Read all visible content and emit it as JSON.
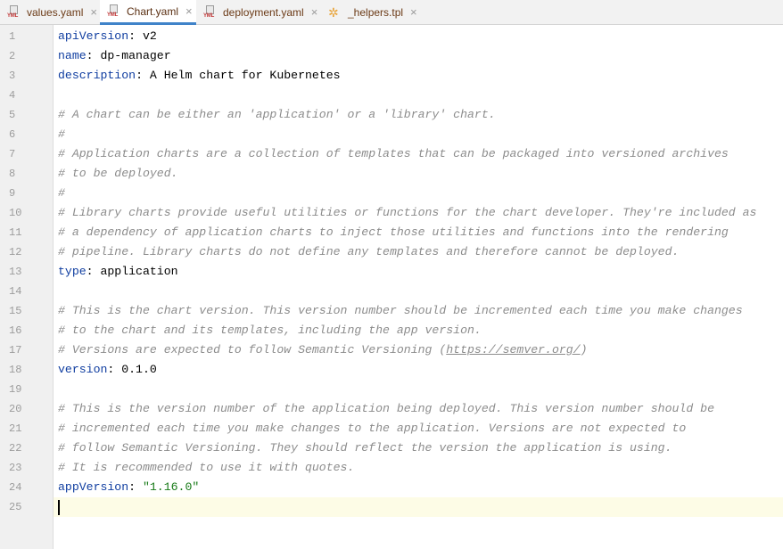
{
  "tabs": [
    {
      "name": "values.yaml",
      "type": "yml",
      "close": "×",
      "active": false
    },
    {
      "name": "Chart.yaml",
      "type": "yml",
      "close": "×",
      "active": true
    },
    {
      "name": "deployment.yaml",
      "type": "yml",
      "close": "×",
      "active": false
    },
    {
      "name": "_helpers.tpl",
      "type": "tpl",
      "close": "×",
      "active": false
    }
  ],
  "file_icon_label": "YML",
  "editor": {
    "current_line": 25,
    "lines": [
      {
        "n": "1",
        "segs": [
          {
            "t": "apiVersion",
            "c": "key"
          },
          {
            "t": ": v2",
            "c": ""
          }
        ]
      },
      {
        "n": "2",
        "segs": [
          {
            "t": "name",
            "c": "key"
          },
          {
            "t": ": dp-manager",
            "c": ""
          }
        ]
      },
      {
        "n": "3",
        "segs": [
          {
            "t": "description",
            "c": "key"
          },
          {
            "t": ": A Helm chart for Kubernetes",
            "c": ""
          }
        ]
      },
      {
        "n": "4",
        "segs": []
      },
      {
        "n": "5",
        "segs": [
          {
            "t": "# A chart can be either an 'application' or a 'library' chart.",
            "c": "cmt"
          }
        ]
      },
      {
        "n": "6",
        "segs": [
          {
            "t": "#",
            "c": "cmt"
          }
        ]
      },
      {
        "n": "7",
        "segs": [
          {
            "t": "# Application charts are a collection of templates that can be packaged into versioned archives",
            "c": "cmt"
          }
        ]
      },
      {
        "n": "8",
        "segs": [
          {
            "t": "# to be deployed.",
            "c": "cmt"
          }
        ]
      },
      {
        "n": "9",
        "segs": [
          {
            "t": "#",
            "c": "cmt"
          }
        ]
      },
      {
        "n": "10",
        "segs": [
          {
            "t": "# Library charts provide useful utilities or functions for the chart developer. They're included as",
            "c": "cmt"
          }
        ]
      },
      {
        "n": "11",
        "segs": [
          {
            "t": "# a dependency of application charts to inject those utilities and functions into the rendering",
            "c": "cmt"
          }
        ]
      },
      {
        "n": "12",
        "segs": [
          {
            "t": "# pipeline. Library charts do not define any templates and therefore cannot be deployed.",
            "c": "cmt"
          }
        ]
      },
      {
        "n": "13",
        "segs": [
          {
            "t": "type",
            "c": "key"
          },
          {
            "t": ": application",
            "c": ""
          }
        ]
      },
      {
        "n": "14",
        "segs": []
      },
      {
        "n": "15",
        "segs": [
          {
            "t": "# This is the chart version. This version number should be incremented each time you make changes",
            "c": "cmt"
          }
        ]
      },
      {
        "n": "16",
        "segs": [
          {
            "t": "# to the chart and its templates, including the app version.",
            "c": "cmt"
          }
        ]
      },
      {
        "n": "17",
        "segs": [
          {
            "t": "# Versions are expected to follow Semantic Versioning (",
            "c": "cmt"
          },
          {
            "t": "https://semver.org/",
            "c": "cmt link"
          },
          {
            "t": ")",
            "c": "cmt"
          }
        ]
      },
      {
        "n": "18",
        "segs": [
          {
            "t": "version",
            "c": "key"
          },
          {
            "t": ": 0.1.0",
            "c": ""
          }
        ]
      },
      {
        "n": "19",
        "segs": []
      },
      {
        "n": "20",
        "segs": [
          {
            "t": "# This is the version number of the application being deployed. This version number should be",
            "c": "cmt"
          }
        ]
      },
      {
        "n": "21",
        "segs": [
          {
            "t": "# incremented each time you make changes to the application. Versions are not expected to",
            "c": "cmt"
          }
        ]
      },
      {
        "n": "22",
        "segs": [
          {
            "t": "# follow Semantic Versioning. They should reflect the version the application is using.",
            "c": "cmt"
          }
        ]
      },
      {
        "n": "23",
        "segs": [
          {
            "t": "# It is recommended to use it with quotes.",
            "c": "cmt"
          }
        ]
      },
      {
        "n": "24",
        "segs": [
          {
            "t": "appVersion",
            "c": "key"
          },
          {
            "t": ": ",
            "c": ""
          },
          {
            "t": "\"1.16.0\"",
            "c": "str"
          }
        ]
      },
      {
        "n": "25",
        "segs": []
      }
    ]
  },
  "colors": {
    "key": "#0f3da0",
    "string": "#177a17",
    "comment": "#8c8c8c",
    "active_tab_underline": "#4083c9",
    "current_line": "#fdfce6"
  }
}
